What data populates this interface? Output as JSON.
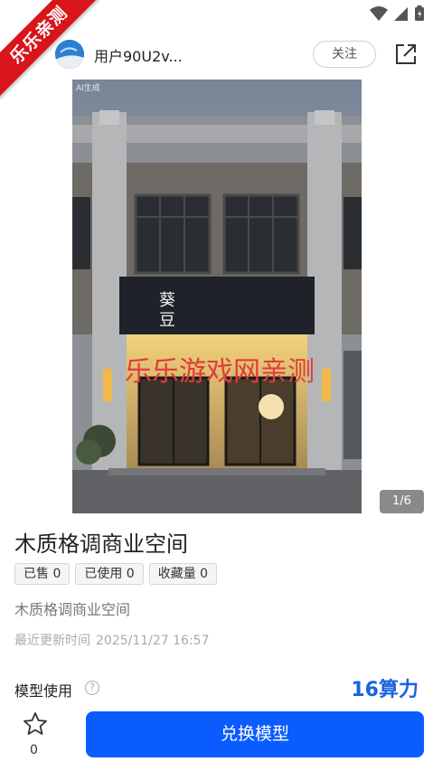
{
  "ribbon": {
    "text": "乐乐亲测"
  },
  "header": {
    "username": "用户90U2v...",
    "follow_label": "关注"
  },
  "gallery": {
    "ai_watermark": "AI生成",
    "watermark": "乐乐游戏网亲测",
    "pager": "1/6"
  },
  "product": {
    "title": "木质格调商业空间",
    "stats": [
      {
        "label": "已售 0"
      },
      {
        "label": "已使用 0"
      },
      {
        "label": "收藏量 0"
      }
    ],
    "description": "木质格调商业空间",
    "updated_label": "最近更新时间",
    "updated_time": "2025/11/27 16:57",
    "usage_label": "模型使用",
    "help_glyph": "?",
    "price": "16算力"
  },
  "bottom_bar": {
    "favorite_count": "0",
    "redeem_label": "兑换模型"
  },
  "colors": {
    "accent": "#0a5cff",
    "price": "#1b62e0",
    "ribbon": "#d9141b"
  }
}
